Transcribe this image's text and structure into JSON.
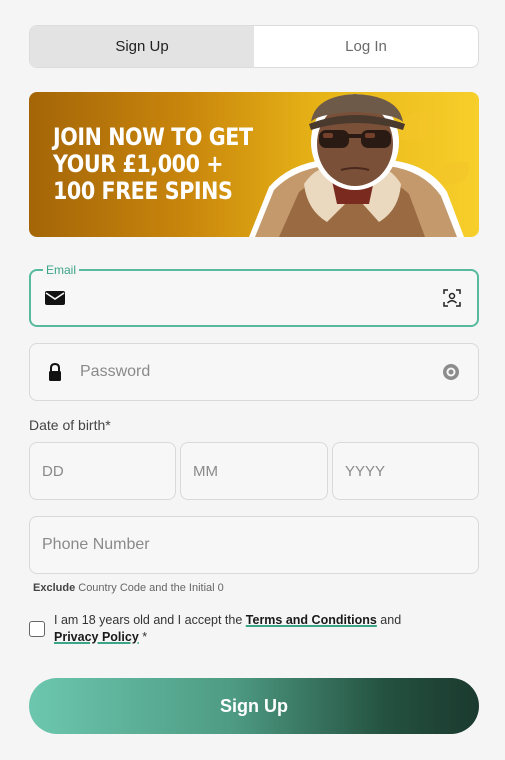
{
  "tabs": {
    "signup": "Sign Up",
    "login": "Log In"
  },
  "banner": {
    "line1": "JOIN NOW TO GET",
    "line2": "YOUR £1,000 +",
    "line3": "100 FREE SPINS"
  },
  "email": {
    "label": "Email",
    "value": ""
  },
  "password": {
    "placeholder": "Password"
  },
  "dob": {
    "label": "Date of birth*",
    "day": "DD",
    "month": "MM",
    "year": "YYYY"
  },
  "phone": {
    "placeholder": "Phone Number"
  },
  "hint": {
    "bold": "Exclude",
    "text": " Country Code and the Initial 0"
  },
  "terms": {
    "pre": "I am 18 years old and I accept the ",
    "terms_link": "Terms and Conditions",
    "mid": " and",
    "privacy_link": "Privacy Policy",
    "post": " *"
  },
  "submit": {
    "label": "Sign Up"
  },
  "colors": {
    "accent": "#57b99d",
    "button_start": "#6cc7ae",
    "button_end": "#1b3a2f",
    "banner": "#c9860c"
  }
}
